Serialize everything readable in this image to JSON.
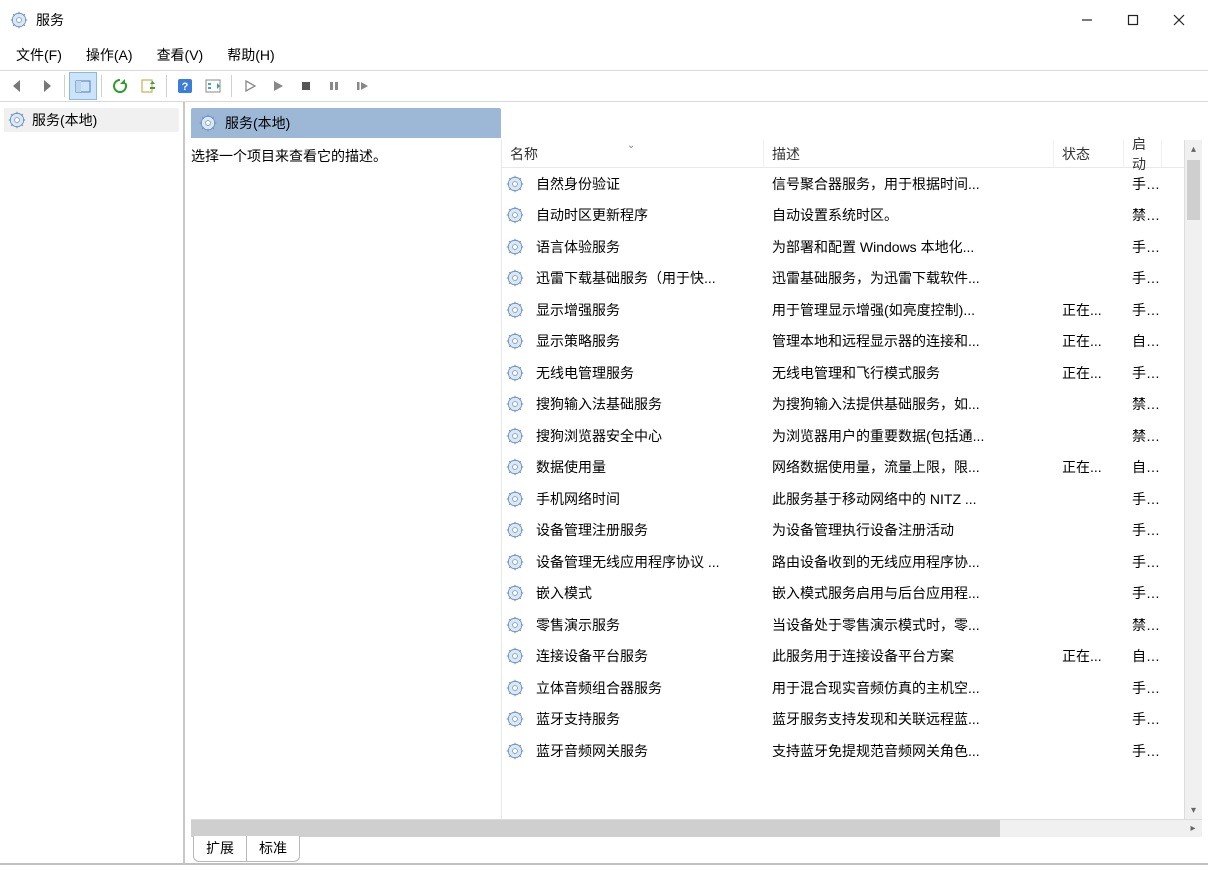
{
  "window": {
    "title": "服务"
  },
  "menu": {
    "file": "文件(F)",
    "action": "操作(A)",
    "view": "查看(V)",
    "help": "帮助(H)"
  },
  "tree": {
    "root": "服务(本地)"
  },
  "pane": {
    "title": "服务(本地)",
    "hint": "选择一个项目来查看它的描述。"
  },
  "columns": {
    "name": "名称",
    "desc": "描述",
    "state": "状态",
    "start": "启动"
  },
  "tabs": {
    "extended": "扩展",
    "standard": "标准"
  },
  "services": [
    {
      "name": "自然身份验证",
      "desc": "信号聚合器服务，用于根据时间...",
      "state": "",
      "start": "手动"
    },
    {
      "name": "自动时区更新程序",
      "desc": "自动设置系统时区。",
      "state": "",
      "start": "禁用"
    },
    {
      "name": "语言体验服务",
      "desc": "为部署和配置 Windows 本地化...",
      "state": "",
      "start": "手动"
    },
    {
      "name": "迅雷下载基础服务（用于快...",
      "desc": "迅雷基础服务，为迅雷下载软件...",
      "state": "",
      "start": "手动"
    },
    {
      "name": "显示增强服务",
      "desc": "用于管理显示增强(如亮度控制)...",
      "state": "正在...",
      "start": "手动"
    },
    {
      "name": "显示策略服务",
      "desc": "管理本地和远程显示器的连接和...",
      "state": "正在...",
      "start": "自动"
    },
    {
      "name": "无线电管理服务",
      "desc": "无线电管理和飞行模式服务",
      "state": "正在...",
      "start": "手动"
    },
    {
      "name": "搜狗输入法基础服务",
      "desc": "为搜狗输入法提供基础服务，如...",
      "state": "",
      "start": "禁用"
    },
    {
      "name": "搜狗浏览器安全中心",
      "desc": "为浏览器用户的重要数据(包括通...",
      "state": "",
      "start": "禁用"
    },
    {
      "name": "数据使用量",
      "desc": "网络数据使用量，流量上限，限...",
      "state": "正在...",
      "start": "自动"
    },
    {
      "name": "手机网络时间",
      "desc": "此服务基于移动网络中的 NITZ ...",
      "state": "",
      "start": "手动"
    },
    {
      "name": "设备管理注册服务",
      "desc": "为设备管理执行设备注册活动",
      "state": "",
      "start": "手动"
    },
    {
      "name": "设备管理无线应用程序协议 ...",
      "desc": "路由设备收到的无线应用程序协...",
      "state": "",
      "start": "手动"
    },
    {
      "name": "嵌入模式",
      "desc": "嵌入模式服务启用与后台应用程...",
      "state": "",
      "start": "手动"
    },
    {
      "name": "零售演示服务",
      "desc": "当设备处于零售演示模式时，零...",
      "state": "",
      "start": "禁用"
    },
    {
      "name": "连接设备平台服务",
      "desc": "此服务用于连接设备平台方案",
      "state": "正在...",
      "start": "自动"
    },
    {
      "name": "立体音频组合器服务",
      "desc": "用于混合现实音频仿真的主机空...",
      "state": "",
      "start": "手动"
    },
    {
      "name": "蓝牙支持服务",
      "desc": "蓝牙服务支持发现和关联远程蓝...",
      "state": "",
      "start": "手动"
    },
    {
      "name": "蓝牙音频网关服务",
      "desc": "支持蓝牙免提规范音频网关角色...",
      "state": "",
      "start": "手动"
    }
  ]
}
